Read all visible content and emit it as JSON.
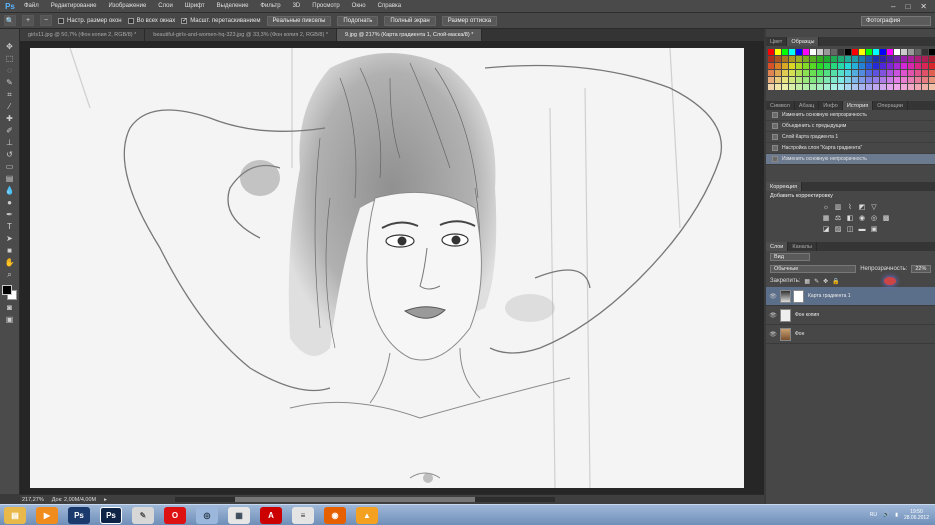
{
  "menubar": {
    "logo": "Ps",
    "items": [
      "Файл",
      "Редактирование",
      "Изображение",
      "Слои",
      "Шрифт",
      "Выделение",
      "Фильтр",
      "3D",
      "Просмотр",
      "Окно",
      "Справка"
    ]
  },
  "options": {
    "check1": "Настр. размер окон",
    "check2": "Во всех окнах",
    "check3": "Масшт. перетаскиванием",
    "btn1": "Реальные пикселы",
    "btn2": "Подогнать",
    "btn3": "Полный экран",
    "btn4": "Размер оттиска",
    "workspace": "Фотография"
  },
  "tabs": [
    {
      "label": "girls11.jpg @ 50,7% (Фон копия 2, RGB/8) *"
    },
    {
      "label": "beautiful-girls-and-women-hq-323.jpg @ 33,3% (Фон копия 2, RGB/8) *"
    },
    {
      "label": "9.jpg @ 217% (Карта градиента 1, Слой-маска/8) *"
    }
  ],
  "status": {
    "zoom": "217,27%",
    "doc": "Док: 2,00M/4,00M"
  },
  "swatches": {
    "tab1": "Цвет",
    "tab2": "Образцы"
  },
  "history_tabs": [
    "Символ",
    "Абзац",
    "Инфо",
    "История",
    "Операции"
  ],
  "history": [
    "Изменить основную непрозрачность",
    "Объединить с предыдущим",
    "Слой Карта градиента 1",
    "Настройка слоя \"Карта градиента\"",
    "Изменить основную непрозрачность"
  ],
  "adjust": {
    "tab": "Коррекция",
    "title": "Добавить корректировку"
  },
  "layers": {
    "tab1": "Слои",
    "tab2": "Каналы",
    "kind": "Вид",
    "blend": "Обычные",
    "opacity_label": "Непрозрачность:",
    "opacity_value": "22%",
    "lock_label": "Закрепить:",
    "items": [
      "Карта градиента 1",
      "Фон копия",
      "Фон"
    ]
  },
  "taskbar": {
    "time": "19:50",
    "date": "28.06.2012",
    "lang": "RU"
  }
}
